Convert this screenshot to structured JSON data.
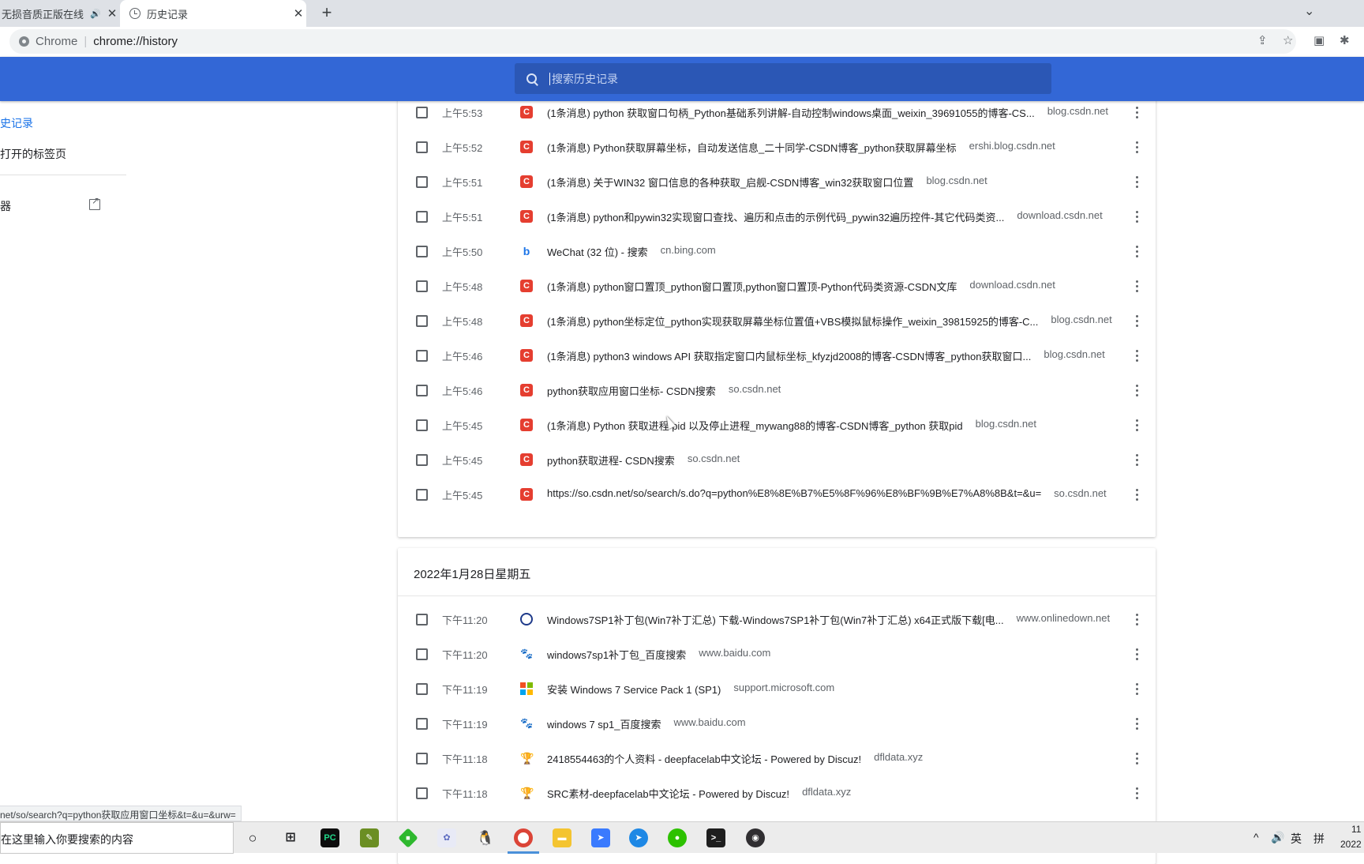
{
  "browser": {
    "tabs": [
      {
        "title": "无损音质正版在线",
        "has_audio": true
      },
      {
        "title": "历史记录",
        "active": true
      }
    ],
    "omnibox": {
      "label": "Chrome",
      "url": "chrome://history"
    }
  },
  "search": {
    "placeholder": "搜索历史记录"
  },
  "sidebar": {
    "items": [
      {
        "label": "史记录"
      },
      {
        "label": "打开的标签页"
      },
      {
        "label": "器"
      }
    ]
  },
  "sections": [
    {
      "date": "",
      "rows": [
        {
          "time": "上午5:53",
          "favicon": "csdn",
          "title": "(1条消息) python 获取窗口句柄_Python基础系列讲解-自动控制windows桌面_weixin_39691055的博客-CS...",
          "domain": "blog.csdn.net"
        },
        {
          "time": "上午5:52",
          "favicon": "csdn",
          "title": "(1条消息) Python获取屏幕坐标，自动发送信息_二十同学-CSDN博客_python获取屏幕坐标",
          "domain": "ershi.blog.csdn.net"
        },
        {
          "time": "上午5:51",
          "favicon": "csdn",
          "title": "(1条消息) 关于WIN32 窗口信息的各种获取_启舰-CSDN博客_win32获取窗口位置",
          "domain": "blog.csdn.net"
        },
        {
          "time": "上午5:51",
          "favicon": "csdn",
          "title": "(1条消息) python和pywin32实现窗口查找、遍历和点击的示例代码_pywin32遍历控件-其它代码类资...",
          "domain": "download.csdn.net"
        },
        {
          "time": "上午5:50",
          "favicon": "bing",
          "title": "WeChat (32 位) - 搜索",
          "domain": "cn.bing.com"
        },
        {
          "time": "上午5:48",
          "favicon": "csdn",
          "title": "(1条消息) python窗口置顶_python窗口置顶,python窗口置顶-Python代码类资源-CSDN文库",
          "domain": "download.csdn.net"
        },
        {
          "time": "上午5:48",
          "favicon": "csdn",
          "title": "(1条消息) python坐标定位_python实现获取屏幕坐标位置值+VBS模拟鼠标操作_weixin_39815925的博客-C...",
          "domain": "blog.csdn.net"
        },
        {
          "time": "上午5:46",
          "favicon": "csdn",
          "title": "(1条消息) python3 windows API 获取指定窗口内鼠标坐标_kfyzjd2008的博客-CSDN博客_python获取窗口...",
          "domain": "blog.csdn.net"
        },
        {
          "time": "上午5:46",
          "favicon": "csdn",
          "title": "python获取应用窗口坐标- CSDN搜索",
          "domain": "so.csdn.net"
        },
        {
          "time": "上午5:45",
          "favicon": "csdn",
          "title": "(1条消息) Python 获取进程 pid 以及停止进程_mywang88的博客-CSDN博客_python 获取pid",
          "domain": "blog.csdn.net"
        },
        {
          "time": "上午5:45",
          "favicon": "csdn",
          "title": "python获取进程- CSDN搜索",
          "domain": "so.csdn.net"
        },
        {
          "time": "上午5:45",
          "favicon": "csdn",
          "title": "https://so.csdn.net/so/search/s.do?q=python%E8%8E%B7%E5%8F%96%E8%BF%9B%E7%A8%8B&t=&u=",
          "domain": "so.csdn.net"
        }
      ]
    },
    {
      "date": "2022年1月28日星期五",
      "rows": [
        {
          "time": "下午11:20",
          "favicon": "onlinedown",
          "title": "Windows7SP1补丁包(Win7补丁汇总) 下载-Windows7SP1补丁包(Win7补丁汇总) x64正式版下载[电...",
          "domain": "www.onlinedown.net"
        },
        {
          "time": "下午11:20",
          "favicon": "baidu",
          "title": "windows7sp1补丁包_百度搜索",
          "domain": "www.baidu.com"
        },
        {
          "time": "下午11:19",
          "favicon": "ms",
          "title": "安装 Windows 7 Service Pack 1 (SP1)",
          "domain": "support.microsoft.com"
        },
        {
          "time": "下午11:19",
          "favicon": "baidu",
          "title": "windows 7 sp1_百度搜索",
          "domain": "www.baidu.com"
        },
        {
          "time": "下午11:18",
          "favicon": "cup",
          "title": "2418554463的个人资料 - deepfacelab中文论坛 - Powered by Discuz!",
          "domain": "dfldata.xyz"
        },
        {
          "time": "下午11:18",
          "favicon": "cup",
          "title": "SRC素材-deepfacelab中文论坛 - Powered by Discuz!",
          "domain": "dfldata.xyz"
        }
      ]
    }
  ],
  "statusbar": {
    "url": "net/so/search?q=python获取应用窗口坐标&t=&u=&urw="
  },
  "taskbar": {
    "search_placeholder": "在这里输入你要搜索的内容",
    "apps": [
      "cortana",
      "task-view",
      "pycharm",
      "notepad",
      "diamond-app",
      "network-app",
      "qq",
      "chrome",
      "file-explorer",
      "feishu",
      "navigation-app",
      "wechat",
      "terminal",
      "obs"
    ],
    "tray": {
      "ime_lang": "英",
      "ime_mode": "拼",
      "time": "11",
      "date": "2022"
    }
  },
  "colors": {
    "header": "#3367d6",
    "search_bg": "#2b57b5",
    "csdn": "#e53e30"
  }
}
